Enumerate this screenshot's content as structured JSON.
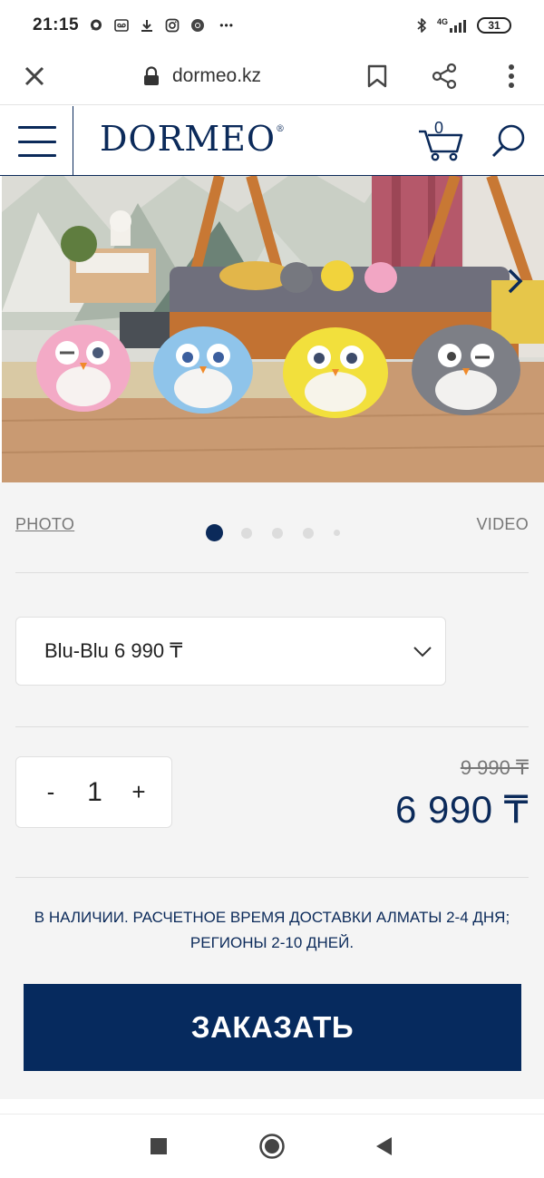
{
  "status_bar": {
    "time": "21:15",
    "network": "4G",
    "battery": "31",
    "more": "•••"
  },
  "browser": {
    "url": "dormeo.kz"
  },
  "header": {
    "logo": "DORMEO",
    "logo_mark": "®",
    "cart_count": "0"
  },
  "gallery": {
    "photo_tab": "PHOTO",
    "video_tab": "VIDEO",
    "slide_count": 5,
    "active_slide": 1
  },
  "product": {
    "variant": "Blu-Blu 6 990 ₸",
    "quantity": "1",
    "qty_minus": "-",
    "qty_plus": "+",
    "old_price": "9 990 ₸",
    "price": "6 990 ₸",
    "availability_line1": "В НАЛИЧИИ. РАСЧЕТНОЕ ВРЕМЯ ДОСТАВКИ АЛМАТЫ 2-4 ДНЯ;",
    "availability_line2": "РЕГИОНЫ 2-10 ДНЕЙ.",
    "order_button": "ЗАКАЗАТЬ"
  },
  "colors": {
    "brand": "#0b2a5a",
    "button": "#062a5e",
    "panel": "#f4f4f4"
  }
}
